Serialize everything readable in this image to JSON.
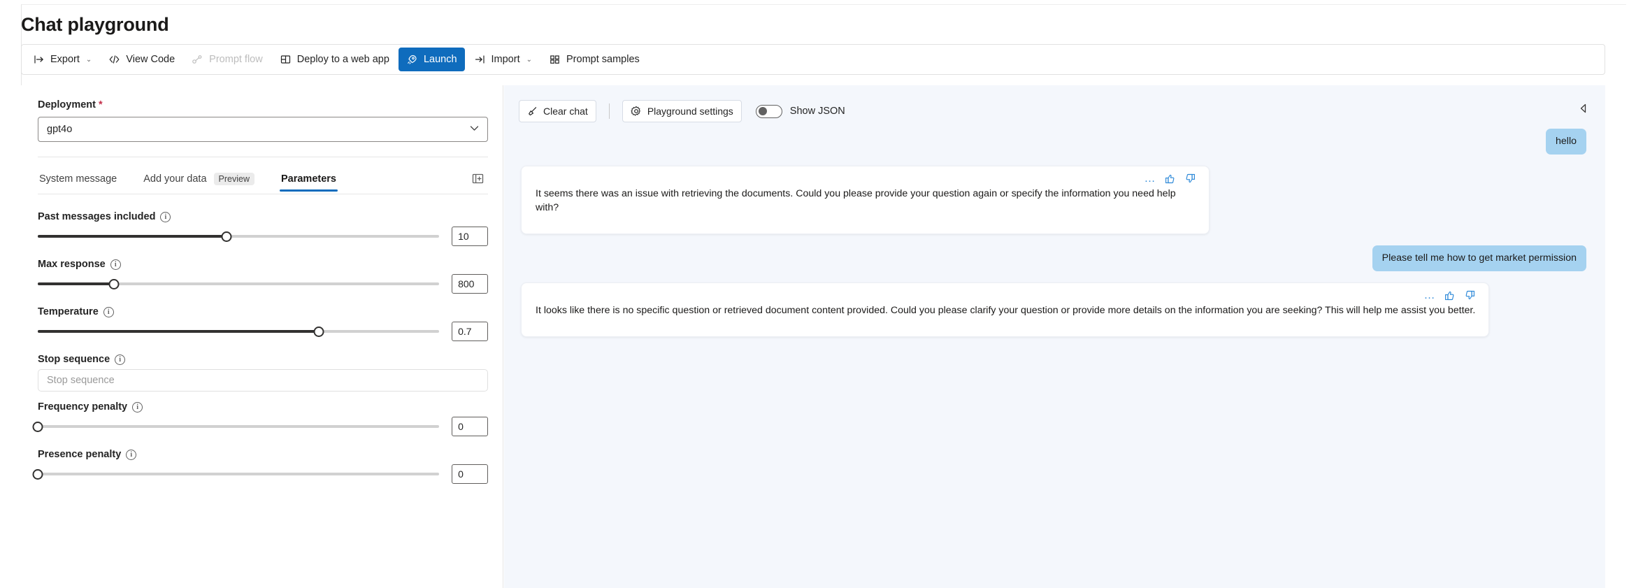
{
  "header": {
    "title": "Chat playground"
  },
  "commandbar": {
    "items": [
      {
        "label": "Export",
        "icon": "export-icon",
        "has_chevron": true,
        "disabled": false,
        "primary": false
      },
      {
        "label": "View Code",
        "icon": "code-icon",
        "has_chevron": false,
        "disabled": false,
        "primary": false
      },
      {
        "label": "Prompt flow",
        "icon": "prompt-flow-icon",
        "has_chevron": false,
        "disabled": true,
        "primary": false
      },
      {
        "label": "Deploy to a web app",
        "icon": "deploy-icon",
        "has_chevron": false,
        "disabled": false,
        "primary": false
      },
      {
        "label": "Launch",
        "icon": "rocket-icon",
        "has_chevron": false,
        "disabled": false,
        "primary": true
      },
      {
        "label": "Import",
        "icon": "import-icon",
        "has_chevron": true,
        "disabled": false,
        "primary": false
      },
      {
        "label": "Prompt samples",
        "icon": "grid-icon",
        "has_chevron": false,
        "disabled": false,
        "primary": false
      }
    ],
    "chevron_glyph": "⌄"
  },
  "left_panel": {
    "deployment": {
      "label": "Deployment",
      "required_mark": "*",
      "value": "gpt4o"
    },
    "tabs": [
      {
        "label": "System message",
        "active": false,
        "badge": null
      },
      {
        "label": "Add your data",
        "active": false,
        "badge": "Preview"
      },
      {
        "label": "Parameters",
        "active": true,
        "badge": null
      }
    ],
    "parameters": [
      {
        "label": "Past messages included",
        "value": "10",
        "percent": 47,
        "type": "slider"
      },
      {
        "label": "Max response",
        "value": "800",
        "percent": 19,
        "type": "slider"
      },
      {
        "label": "Temperature",
        "value": "0.7",
        "percent": 70,
        "type": "slider"
      },
      {
        "label": "Stop sequence",
        "value": "",
        "placeholder": "Stop sequence",
        "type": "text"
      },
      {
        "label": "Frequency penalty",
        "value": "0",
        "percent": 0,
        "type": "slider"
      },
      {
        "label": "Presence penalty",
        "value": "0",
        "percent": 0,
        "type": "slider"
      }
    ]
  },
  "chat": {
    "toolbar": {
      "clear_chat": "Clear chat",
      "playground_settings": "Playground settings",
      "show_json": "Show JSON",
      "show_json_on": false
    },
    "messages": [
      {
        "role": "user",
        "text": "hello"
      },
      {
        "role": "assistant",
        "text": "It seems there was an issue with retrieving the documents. Could you please provide your question again or specify the information you need help with?",
        "width_class": "msg-w1"
      },
      {
        "role": "user",
        "text": "Please tell me how to get market permission"
      },
      {
        "role": "assistant",
        "text": "It looks like there is no specific question or retrieved document content provided. Could you please clarify your question or provide more details on the information you are seeking? This will help me assist you better.",
        "width_class": "msg-w2"
      }
    ],
    "message_actions": {
      "more": "…",
      "thumbs_up": "thumbs-up-icon",
      "thumbs_down": "thumbs-down-icon"
    }
  },
  "colors": {
    "accent": "#0f6cbd",
    "user_bubble": "#a5d2f0",
    "chat_background": "#f4f7fc",
    "required": "#c4314b",
    "action_blue": "#2b88d8"
  }
}
